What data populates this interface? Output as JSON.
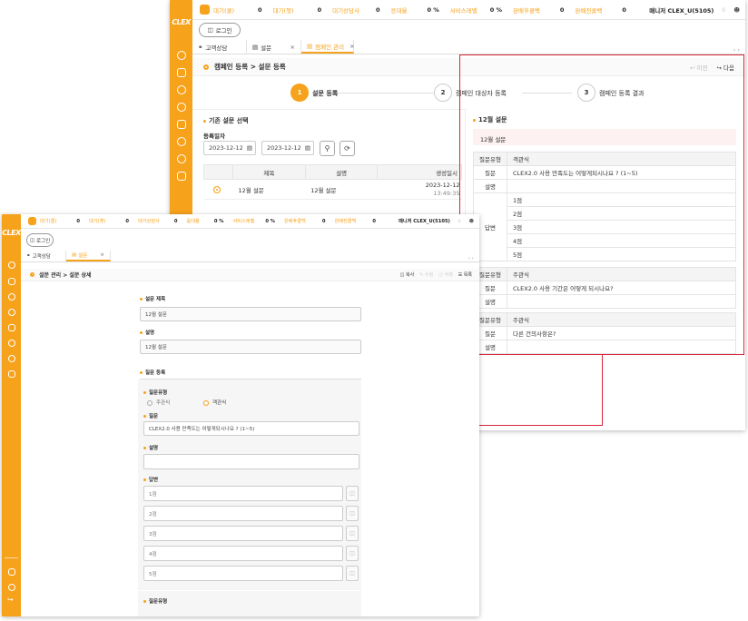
{
  "back": {
    "logo": "CLEX",
    "topbar": {
      "stats": [
        {
          "label": "대기(콜)",
          "value": "0"
        },
        {
          "label": "대기(챗)",
          "value": "0"
        },
        {
          "label": "대기상담사",
          "value": "0"
        },
        {
          "label": "응대율",
          "value": "0 %"
        },
        {
          "label": "서비스레벨",
          "value": "0 %"
        },
        {
          "label": "완배후콜백",
          "value": "0"
        },
        {
          "label": "완배전콜백",
          "value": "0"
        }
      ],
      "manager": "매니저 CLEX_U(5105)",
      "login": "로그인"
    },
    "tabs": [
      {
        "label": "고객상담"
      },
      {
        "label": "설문"
      },
      {
        "label": "캠페인 관리"
      }
    ],
    "page_title": "캠페인 등록 > 설문 등록",
    "prev": "이전",
    "next": "다음",
    "steps": [
      {
        "num": "1",
        "label": "설문 등록"
      },
      {
        "num": "2",
        "label": "캠페인 대상자 등록"
      },
      {
        "num": "3",
        "label": "캠페인 등록 결과"
      }
    ],
    "left": {
      "section": "기존 설문 선택",
      "date_label": "등록일자",
      "date_from": "2023-12-12",
      "date_to": "2023-12-12",
      "table": {
        "headers": [
          "제목",
          "설명",
          "생성일시"
        ],
        "rows": [
          {
            "title": "12월 설문",
            "desc": "12월 설문",
            "date": "2023-12-12",
            "time": "13:49:35"
          }
        ]
      }
    },
    "right": {
      "section": "12월 설문",
      "title_row": "12월 설문",
      "blocks": [
        {
          "type_label": "질문유형",
          "type": "객관식",
          "q_label": "질문",
          "question": "CLEX2.0 사용 만족도는 어떻게되시나요 ? (1~5)",
          "d_label": "설명",
          "a_label": "답변",
          "answers": [
            "1점",
            "2점",
            "3점",
            "4점",
            "5점"
          ]
        },
        {
          "type_label": "질문유형",
          "type": "주관식",
          "q_label": "질문",
          "question": "CLEX2.0 사용 기간은 어떻게 되시나요?",
          "d_label": "설명"
        },
        {
          "type_label": "질문유형",
          "type": "주관식",
          "q_label": "질문",
          "question": "다른 건의사항은?",
          "d_label": "설명"
        }
      ]
    }
  },
  "front": {
    "logo": "CLEX",
    "topbar": {
      "stats": [
        {
          "label": "대기(콜)",
          "value": "0"
        },
        {
          "label": "대기(챗)",
          "value": "0"
        },
        {
          "label": "대기상담사",
          "value": "0"
        },
        {
          "label": "응대율",
          "value": "0 %"
        },
        {
          "label": "서비스레벨",
          "value": "0 %"
        },
        {
          "label": "완배후콜백",
          "value": "0"
        },
        {
          "label": "완배전콜백",
          "value": "0"
        }
      ],
      "manager": "매니저 CLEX_U(5105)",
      "login": "로그인"
    },
    "tabs": [
      {
        "label": "고객상담"
      },
      {
        "label": "설문"
      }
    ],
    "page_title": "설문 관리 > 설문 상세",
    "toolbar": {
      "copy": "복사",
      "edit": "수정",
      "delete": "삭제",
      "list": "목록"
    },
    "form": {
      "title_label": "설문 제목",
      "title_value": "12월 설문",
      "desc_label": "설명",
      "desc_value": "12월 설문",
      "reg_label": "질문 등록",
      "qtype_label": "질문유형",
      "opt_subjective": "주관식",
      "opt_objective": "객관식",
      "q_label": "질문",
      "q_value": "CLEX2.0 사용 만족도는 어떻게되시나요 ? (1~5)",
      "d_label": "설명",
      "a_label": "답변",
      "answers": [
        "1점",
        "2점",
        "3점",
        "4점",
        "5점"
      ],
      "qtype2_label": "질문유형"
    }
  }
}
